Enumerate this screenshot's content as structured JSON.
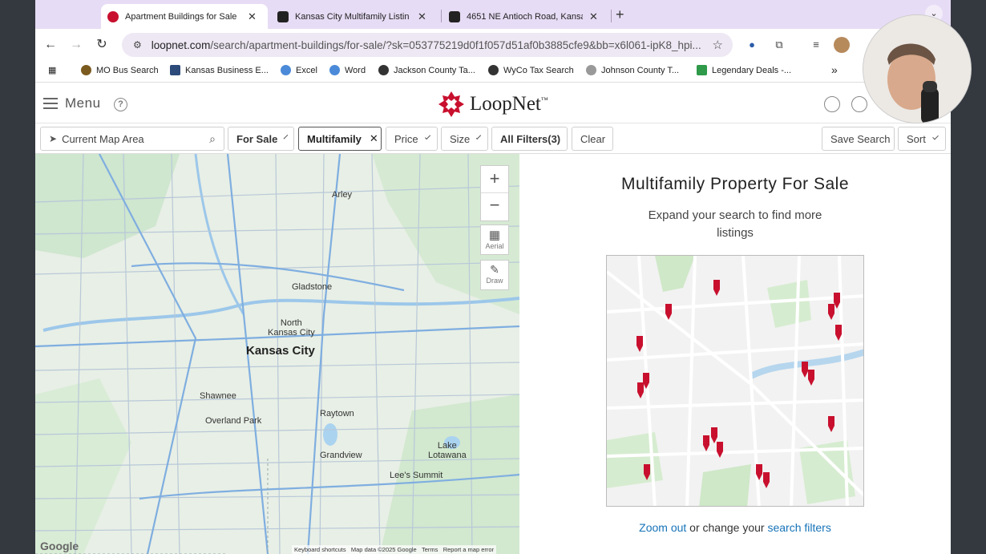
{
  "tabs": [
    {
      "title": "Apartment Buildings for Sale",
      "active": true
    },
    {
      "title": "Kansas City Multifamily Listin",
      "active": false
    },
    {
      "title": "4651 NE Antioch Road, Kansa",
      "active": false
    }
  ],
  "toolbar": {
    "url_domain": "loopnet.com",
    "url_path": "/search/apartment-buildings/for-sale/?sk=053775219d0f1f057d51af0b3885cfe9&bb=x6l061-ipK8_hpi..."
  },
  "bookmarks": [
    {
      "label": "MO Bus Search"
    },
    {
      "label": "Kansas Business E..."
    },
    {
      "label": "Excel"
    },
    {
      "label": "Word"
    },
    {
      "label": "Jackson County Ta..."
    },
    {
      "label": "WyCo Tax Search"
    },
    {
      "label": "Johnson County T..."
    },
    {
      "label": "Legendary Deals -..."
    }
  ],
  "header": {
    "menu_label": "Menu",
    "help_label": "?",
    "logo_text": "LoopNet",
    "logo_tm": "™"
  },
  "filters": {
    "location_placeholder": "Current Map Area",
    "for_sale": "For Sale",
    "multifamily": "Multifamily",
    "price": "Price",
    "size": "Size",
    "all_filters": "All Filters(3)",
    "clear": "Clear",
    "save_search": "Save Search",
    "sort": "Sort"
  },
  "map": {
    "aerial_label": "Aerial",
    "draw_label": "Draw",
    "labels": {
      "arley": "Arley",
      "gladstone": "Gladstone",
      "north_kansas_city": "North\nKansas City",
      "kansas_city": "Kansas City",
      "shawnee": "Shawnee",
      "raytown": "Raytown",
      "overland_park": "Overland Park",
      "grandview": "Grandview",
      "lake_lotawana": "Lake\nLotawana",
      "lees_summit": "Lee's Summit"
    },
    "footer": {
      "keyboard": "Keyboard shortcuts",
      "data": "Map data ©2025 Google",
      "terms": "Terms",
      "report": "Report a map error"
    },
    "google_logo": "Google"
  },
  "results": {
    "title": "Multifamily Property For Sale",
    "subtitle": "Expand your search to find more listings",
    "zoom_out": "Zoom out",
    "or_change": " or change your ",
    "search_filters": "search filters"
  }
}
